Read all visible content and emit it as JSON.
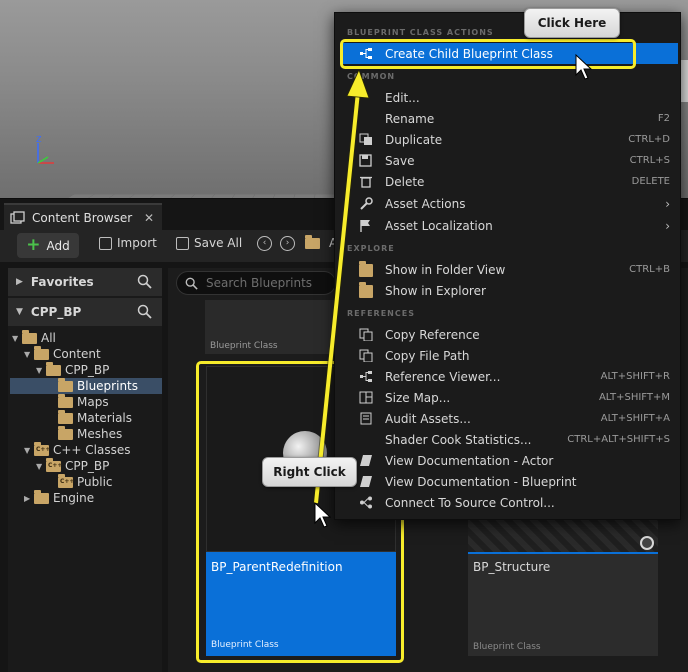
{
  "tab": {
    "title": "Content Browser",
    "close": "✕"
  },
  "toolbar": {
    "add": "Add",
    "import": "Import",
    "save_all": "Save All",
    "truncated": "A"
  },
  "left_panel": {
    "favorites": "Favorites",
    "project": "CPP_BP",
    "tree": [
      "All",
      "Content",
      "CPP_BP",
      "Blueprints",
      "Maps",
      "Materials",
      "Meshes",
      "C++ Classes",
      "CPP_BP",
      "Public",
      "Engine"
    ]
  },
  "search": {
    "placeholder": "Search Blueprints"
  },
  "assets": {
    "top_card_type": "Blueprint Class",
    "selected_name": "BP_ParentRedefinition",
    "selected_type": "Blueprint Class",
    "right_name": "BP_Structure",
    "right_type": "Blueprint Class"
  },
  "menu": {
    "sections": {
      "blueprint": "BLUEPRINT CLASS ACTIONS",
      "common": "COMMON",
      "explore": "EXPLORE",
      "references": "REFERENCES"
    },
    "items": [
      {
        "label": "Create Child Blueprint Class",
        "shortcut": ""
      },
      {
        "label": "Edit...",
        "shortcut": ""
      },
      {
        "label": "Rename",
        "shortcut": "F2"
      },
      {
        "label": "Duplicate",
        "shortcut": "CTRL+D"
      },
      {
        "label": "Save",
        "shortcut": "CTRL+S"
      },
      {
        "label": "Delete",
        "shortcut": "DELETE"
      },
      {
        "label": "Asset Actions",
        "shortcut": ""
      },
      {
        "label": "Asset Localization",
        "shortcut": ""
      },
      {
        "label": "Show in Folder View",
        "shortcut": "CTRL+B"
      },
      {
        "label": "Show in Explorer",
        "shortcut": ""
      },
      {
        "label": "Copy Reference",
        "shortcut": ""
      },
      {
        "label": "Copy File Path",
        "shortcut": ""
      },
      {
        "label": "Reference Viewer...",
        "shortcut": "ALT+SHIFT+R"
      },
      {
        "label": "Size Map...",
        "shortcut": "ALT+SHIFT+M"
      },
      {
        "label": "Audit Assets...",
        "shortcut": "ALT+SHIFT+A"
      },
      {
        "label": "Shader Cook Statistics...",
        "shortcut": "CTRL+ALT+SHIFT+S"
      },
      {
        "label": "View Documentation - Actor",
        "shortcut": ""
      },
      {
        "label": "View Documentation - Blueprint",
        "shortcut": ""
      },
      {
        "label": "Connect To Source Control...",
        "shortcut": ""
      }
    ],
    "submenu_arrow": "›"
  },
  "callouts": {
    "click_here": "Click Here",
    "right_click": "Right Click"
  },
  "colors": {
    "highlight": "#f7ec2b",
    "selection": "#0a70d8",
    "folder": "#c8a566",
    "add_plus": "#4bc24b"
  }
}
